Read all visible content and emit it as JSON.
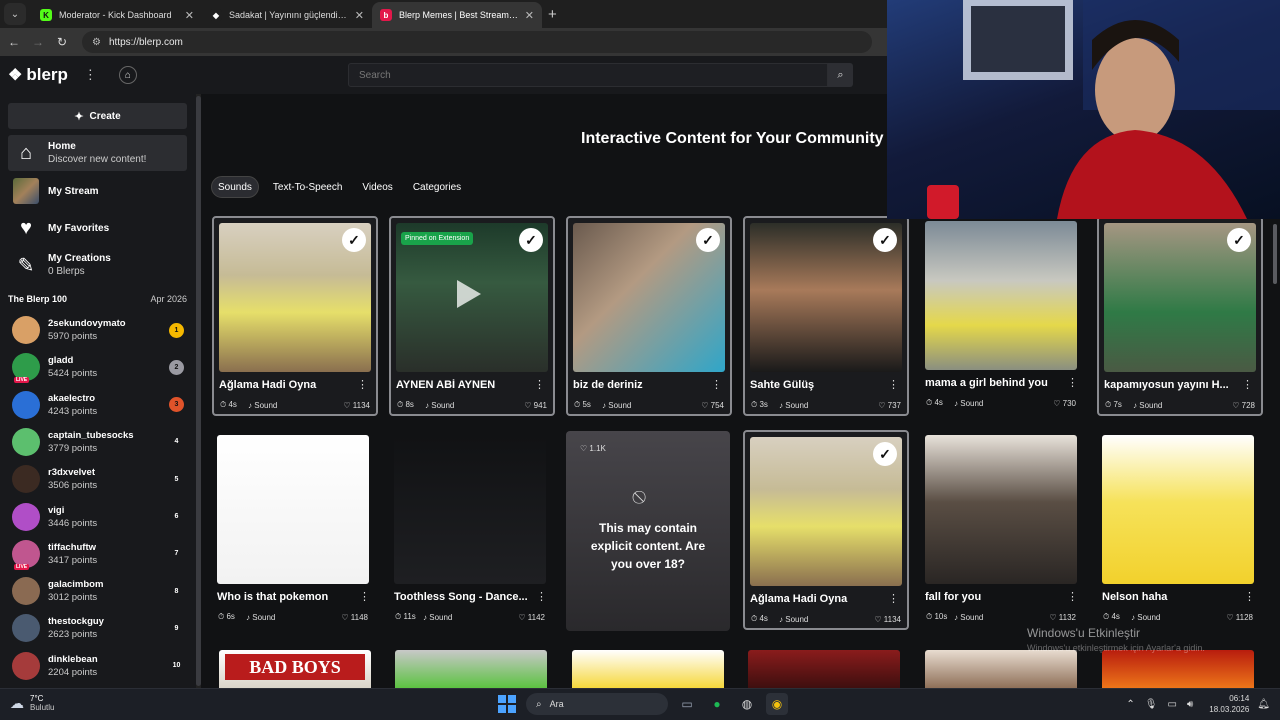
{
  "browser": {
    "tabs": [
      {
        "title": "Moderator - Kick Dashboard",
        "favicon_color": "#53fc18",
        "favicon_letter": "K",
        "active": false
      },
      {
        "title": "Sadakat | Yayınını güçlendirmek",
        "favicon_color": "#ffffff",
        "favicon_letter": "◆",
        "active": false
      },
      {
        "title": "Blerp Memes | Best Streamer S",
        "favicon_color": "#e3174a",
        "favicon_letter": "b",
        "active": true
      }
    ],
    "new_tab": "+",
    "url": "https://blerp.com"
  },
  "header": {
    "logo_text": "blerp",
    "search_placeholder": "Search"
  },
  "sidebar": {
    "create_label": "Create",
    "nav": [
      {
        "title": "Home",
        "subtitle": "Discover new content!",
        "icon": "home-icon"
      },
      {
        "title": "My Stream",
        "subtitle": "",
        "icon": "stream-avatar"
      },
      {
        "title": "My Favorites",
        "subtitle": "",
        "icon": "heart-icon"
      },
      {
        "title": "My Creations",
        "subtitle": "0 Blerps",
        "icon": "magic-wand-icon"
      }
    ],
    "leaderboard_title": "The Blerp 100",
    "leaderboard_date": "Apr 2026",
    "leaderboard": [
      {
        "name": "2sekundovymato",
        "points": "5970 points",
        "rank": "1",
        "badge_color": "#f5b800",
        "avatar_color": "#d9a066",
        "live": false
      },
      {
        "name": "gladd",
        "points": "5424 points",
        "rank": "2",
        "badge_color": "#9a9aa2",
        "avatar_color": "#2e9c4a",
        "live": true
      },
      {
        "name": "akaelectro",
        "points": "4243 points",
        "rank": "3",
        "badge_color": "#e0532a",
        "avatar_color": "#2a6fd6",
        "live": false
      },
      {
        "name": "captain_tubesocks",
        "points": "3779 points",
        "rank": "4",
        "badge_color": "",
        "avatar_color": "#5cbf6e",
        "live": false
      },
      {
        "name": "r3dxvelvet",
        "points": "3506 points",
        "rank": "5",
        "badge_color": "",
        "avatar_color": "#3b2a22",
        "live": false
      },
      {
        "name": "vigi",
        "points": "3446 points",
        "rank": "6",
        "badge_color": "",
        "avatar_color": "#b04ec7",
        "live": false
      },
      {
        "name": "tiffachuftw",
        "points": "3417 points",
        "rank": "7",
        "badge_color": "",
        "avatar_color": "#c0568f",
        "live": true
      },
      {
        "name": "galacimbom",
        "points": "3012 points",
        "rank": "8",
        "badge_color": "",
        "avatar_color": "#8a6a52",
        "live": false
      },
      {
        "name": "thestockguy",
        "points": "2623 points",
        "rank": "9",
        "badge_color": "",
        "avatar_color": "#4a5a70",
        "live": false
      },
      {
        "name": "dinklebean",
        "points": "2204 points",
        "rank": "10",
        "badge_color": "",
        "avatar_color": "#a53b3b",
        "live": false
      }
    ]
  },
  "main": {
    "headline": "Interactive Content for Your Community",
    "filters": [
      "Sounds",
      "Text-To-Speech",
      "Videos",
      "Categories"
    ],
    "active_filter": "Sounds",
    "cards": [
      {
        "title": "Ağlama Hadi Oyna",
        "duration": "4s",
        "kind": "Sound",
        "likes": "1134",
        "selected": true,
        "pinned": "",
        "play": false,
        "thumb": "linear-gradient(180deg,#d8d0c0 0%,#c6bb96 35%,#e6df6a 60%,#8a6f4f 100%)"
      },
      {
        "title": "AYNEN ABİ AYNEN",
        "duration": "8s",
        "kind": "Sound",
        "likes": "941",
        "selected": true,
        "pinned": "Pinned on Extension",
        "play": true,
        "thumb": "linear-gradient(180deg,#1d3a2a 0%,#365a40 40%,#2a2f2a 100%)"
      },
      {
        "title": "biz de deriniz",
        "duration": "5s",
        "kind": "Sound",
        "likes": "754",
        "selected": true,
        "pinned": "",
        "play": false,
        "thumb": "linear-gradient(135deg,#6a5a4e 0%,#b39a82 40%,#2fa6c9 100%)"
      },
      {
        "title": "Sahte Gülüş",
        "duration": "3s",
        "kind": "Sound",
        "likes": "737",
        "selected": true,
        "pinned": "",
        "play": false,
        "thumb": "linear-gradient(180deg,#2c2e28 0%,#a87a5a 45%,#1a1a1a 100%)"
      },
      {
        "title": "mama a girl behind you",
        "duration": "4s",
        "kind": "Sound",
        "likes": "730",
        "selected": false,
        "pinned": "",
        "play": false,
        "thumb": "linear-gradient(180deg,#7c8a96 0%,#c8c8c0 40%,#e5d84a 70%,#8a8f80 100%)"
      },
      {
        "title": "kapamıyosun yayını H...",
        "duration": "7s",
        "kind": "Sound",
        "likes": "728",
        "selected": true,
        "pinned": "",
        "play": false,
        "thumb": "linear-gradient(180deg,#a59682 0%,#2f7a46 60%,#4a5a44 100%)"
      },
      {
        "title": "Who is that pokemon",
        "duration": "6s",
        "kind": "Sound",
        "likes": "1148",
        "selected": false,
        "pinned": "",
        "play": false,
        "thumb": "linear-gradient(180deg,#ffffff 0%,#f2f2f2 100%)"
      },
      {
        "title": "Toothless Song - Dance...",
        "duration": "11s",
        "kind": "Sound",
        "likes": "1142",
        "selected": false,
        "pinned": "",
        "play": false,
        "thumb": "linear-gradient(180deg,#111214 0%,#1e1f22 100%)"
      },
      {
        "title": "Ağlama Hadi Oyna",
        "duration": "4s",
        "kind": "Sound",
        "likes": "1134",
        "selected": true,
        "pinned": "",
        "play": false,
        "thumb": "linear-gradient(180deg,#d8d0c0 0%,#c6bb96 35%,#e6df6a 60%,#8a6f4f 100%)"
      },
      {
        "title": "fall for you",
        "duration": "10s",
        "kind": "Sound",
        "likes": "1132",
        "selected": false,
        "pinned": "",
        "play": false,
        "thumb": "linear-gradient(180deg,#e8e2da 0%,#5a4e44 45%,#2a2624 100%)"
      },
      {
        "title": "Nelson haha",
        "duration": "4s",
        "kind": "Sound",
        "likes": "1128",
        "selected": false,
        "pinned": "",
        "play": false,
        "thumb": "linear-gradient(180deg,#ffffff 0%,#f6e25a 45%,#f2d12c 100%)"
      }
    ],
    "explicit_card": {
      "likes": "1.1K",
      "message": "This may contain explicit content. Are you over 18?"
    }
  },
  "overlay": {
    "activate_title": "Windows'u Etkinleştir",
    "activate_sub": "Windows'u etkinleştirmek için Ayarlar'a gidin."
  },
  "taskbar": {
    "temperature": "7°C",
    "weather": "Bulutlu",
    "search": "Ara",
    "time": "06:14",
    "date": "18.03.2026"
  }
}
